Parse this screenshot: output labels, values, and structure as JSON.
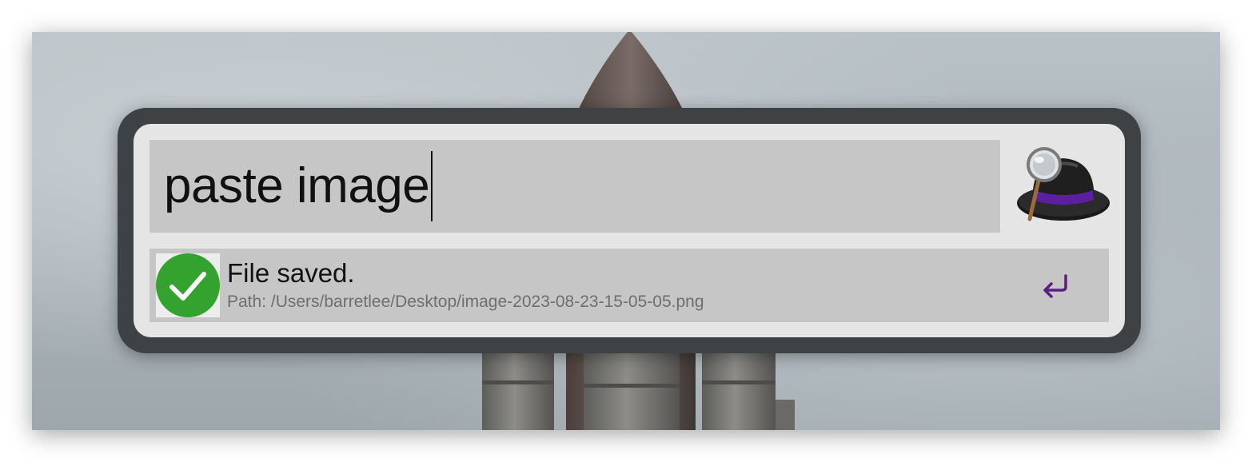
{
  "search": {
    "query": "paste image"
  },
  "result": {
    "title": "File saved.",
    "subtitle": "Path: /Users/barretlee/Desktop/image-2023-08-23-15-05-05.png",
    "icon": "check-icon",
    "action_icon": "return-key-icon"
  },
  "app": {
    "logo": "alfred-hat-logo-icon"
  },
  "colors": {
    "check_green": "#33a22f",
    "return_accent": "#5a1e86",
    "hat_band": "#5c1fa0"
  }
}
